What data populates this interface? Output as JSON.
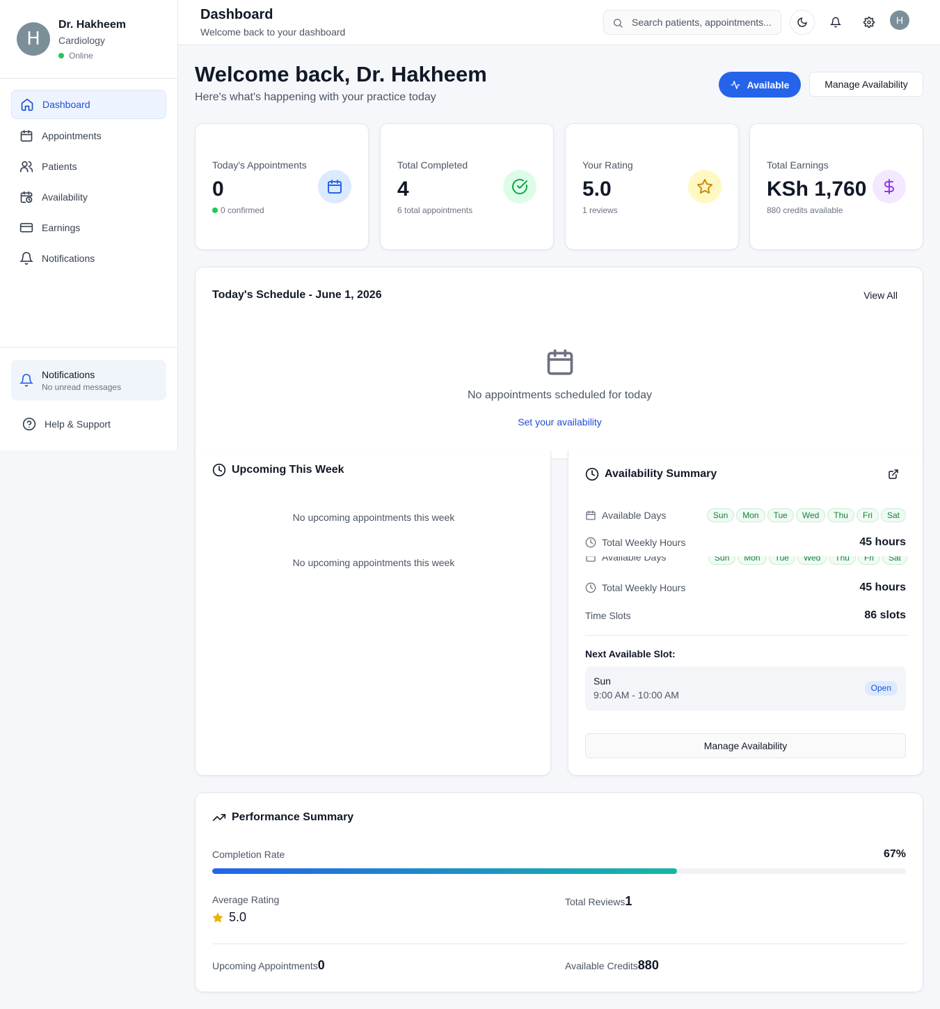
{
  "sidebar": {
    "avatar_initial": "H",
    "name": "Dr. Hakheem",
    "specialty": "Cardiology",
    "status": "Online",
    "nav": [
      {
        "label": "Dashboard",
        "icon": "home-icon"
      },
      {
        "label": "Appointments",
        "icon": "calendar-icon"
      },
      {
        "label": "Patients",
        "icon": "users-icon"
      },
      {
        "label": "Availability",
        "icon": "calendar-clock-icon"
      },
      {
        "label": "Earnings",
        "icon": "credit-card-icon"
      },
      {
        "label": "Notifications",
        "icon": "bell-icon"
      }
    ],
    "notifications_card": {
      "title": "Notifications",
      "subtitle": "No unread messages"
    },
    "help": "Help & Support"
  },
  "header": {
    "title": "Dashboard",
    "subtitle": "Welcome back to your dashboard",
    "search_placeholder": "Search patients, appointments...",
    "avatar_initial": "H"
  },
  "welcome": {
    "title": "Welcome back, Dr. Hakheem",
    "subtitle": "Here's what's happening with your practice today",
    "available_button": "Available",
    "manage_button": "Manage Availability"
  },
  "stats": [
    {
      "label": "Today's Appointments",
      "value": "0",
      "note": "0 confirmed",
      "icon": "calendar-icon",
      "color": "#2563eb",
      "bg": "#dbeafe"
    },
    {
      "label": "Total Completed",
      "value": "4",
      "note": "6 total appointments",
      "icon": "check-circle-icon",
      "color": "#16a34a",
      "bg": "#dcfce7"
    },
    {
      "label": "Your Rating",
      "value": "5.0",
      "note": "1 reviews",
      "icon": "star-icon",
      "color": "#ca8a04",
      "bg": "#fef9c3"
    },
    {
      "label": "Total Earnings",
      "value": "KSh 1,760",
      "note": "880 credits available",
      "icon": "dollar-icon",
      "color": "#9333ea",
      "bg": "#f3e8ff"
    }
  ],
  "schedule": {
    "title": "Today's Schedule - June 1, 2026",
    "view_all": "View All",
    "empty": "No appointments scheduled for today",
    "link": "Set your availability"
  },
  "upcoming": {
    "title": "Upcoming This Week",
    "empty_1": "No upcoming appointments this week",
    "empty_2": "No upcoming appointments this week"
  },
  "availability": {
    "title": "Availability Summary",
    "available_days_label": "Available Days",
    "days": [
      "Sun",
      "Mon",
      "Tue",
      "Wed",
      "Thu",
      "Fri",
      "Sat"
    ],
    "weekly_hours_label": "Total Weekly Hours",
    "weekly_hours": "45 hours",
    "time_slots_label": "Time Slots",
    "time_slots": "86 slots",
    "next_slot_label": "Next Available Slot:",
    "next_slot_day": "Sun",
    "next_slot_time": "9:00 AM - 10:00 AM",
    "next_slot_badge": "Open",
    "manage_button": "Manage Availability"
  },
  "performance": {
    "title": "Performance Summary",
    "completion_label": "Completion Rate",
    "completion_value": "67%",
    "completion_fraction": 0.67,
    "avg_rating_label": "Average Rating",
    "avg_rating": "5.0",
    "total_reviews_label": "Total Reviews",
    "total_reviews": "1",
    "upcoming_label": "Upcoming Appointments",
    "upcoming_value": "0",
    "credits_label": "Available Credits",
    "credits_value": "880"
  },
  "colors": {
    "primary": "#2563eb",
    "online": "#22c55e",
    "progress_start": "#2563eb",
    "progress_end": "#14b8a6"
  }
}
